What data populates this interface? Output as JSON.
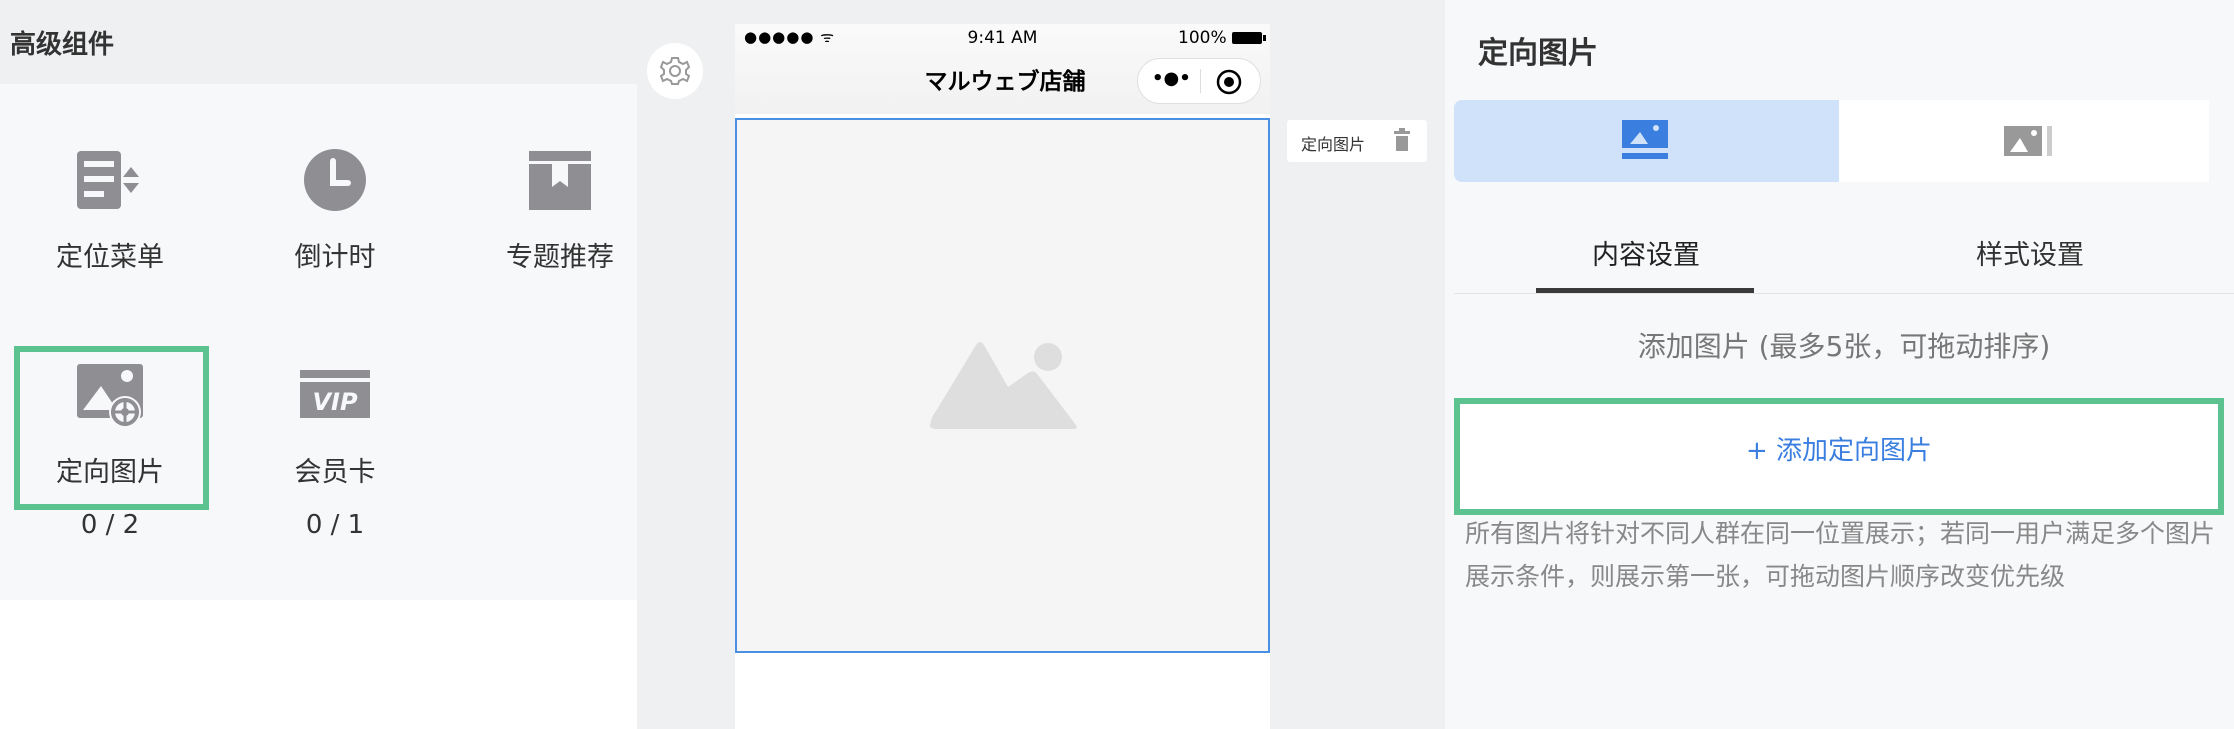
{
  "left_panel": {
    "title": "高级组件",
    "components": [
      {
        "label": "定位菜单",
        "count": "",
        "icon": "positioning-menu-icon"
      },
      {
        "label": "倒计时",
        "count": "",
        "icon": "clock-icon"
      },
      {
        "label": "专题推荐",
        "count": "",
        "icon": "bookmark-box-icon"
      },
      {
        "label": "定向图片",
        "count": "0 / 2",
        "icon": "targeted-image-icon",
        "selected": true
      },
      {
        "label": "会员卡",
        "count": "0 / 1",
        "icon": "vip-card-icon"
      }
    ]
  },
  "phone": {
    "status_signal": "●●●●● ᯤ",
    "status_time": "9:41 AM",
    "status_battery": "100%",
    "title": "マルウェブ店舗",
    "capsule_more": "•●•",
    "component_tag": "定向图片"
  },
  "right_panel": {
    "title": "定向图片",
    "tabs": [
      {
        "label": "内容设置",
        "active": true
      },
      {
        "label": "样式设置",
        "active": false
      }
    ],
    "add_hint": "添加图片 (最多5张，可拖动排序)",
    "add_button": "+ 添加定向图片",
    "description": "所有图片将针对不同人群在同一位置展示；若同一用户满足多个图片展示条件，则展示第一张，可拖动图片顺序改变优先级"
  },
  "colors": {
    "accent_blue": "#3a7fe0",
    "highlight_green": "#5cc290",
    "selected_tab_bg": "#cfe2fa",
    "icon_gray": "#8e8e93"
  }
}
